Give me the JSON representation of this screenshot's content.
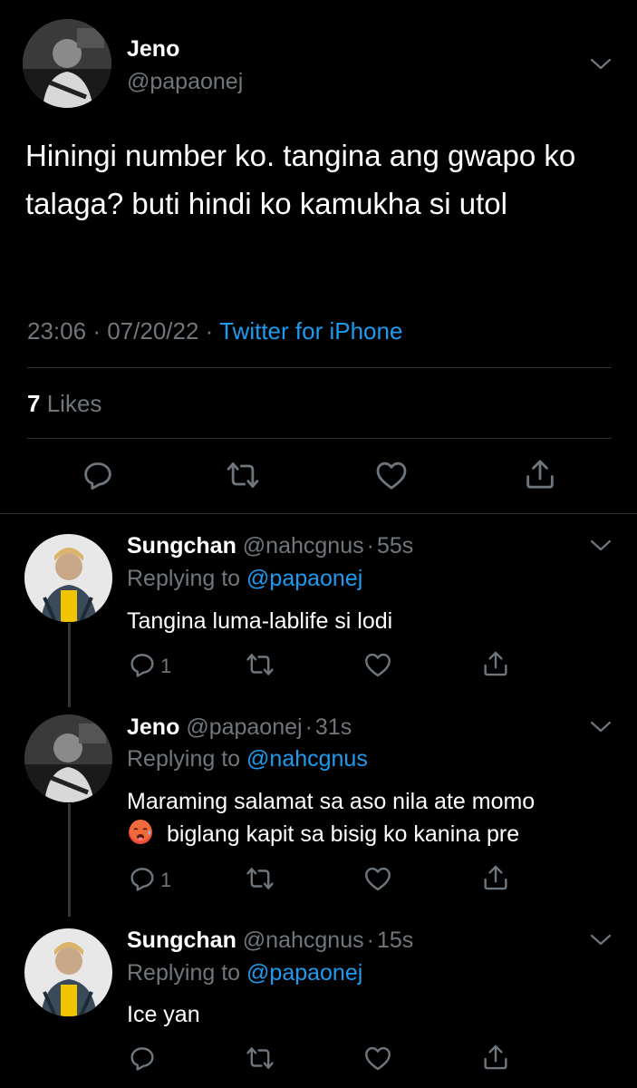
{
  "main_tweet": {
    "display_name": "Jeno",
    "handle": "@papaonej",
    "text": "Hiningi number ko. tangina ang gwapo ko talaga? buti hindi ko kamukha si utol",
    "time": "23:06",
    "date": "07/20/22",
    "source": "Twitter for iPhone",
    "likes_count": "7",
    "likes_label": "Likes",
    "separator": "·"
  },
  "replies": [
    {
      "display_name": "Sungchan",
      "handle": "@nahcgnus",
      "age": "55s",
      "replying_prefix": "Replying to",
      "replying_to": "@papaonej",
      "text": "Tangina luma-lablife si lodi",
      "reply_count": "1"
    },
    {
      "display_name": "Jeno",
      "handle": "@papaonej",
      "age": "31s",
      "replying_prefix": "Replying to",
      "replying_to": "@nahcgnus",
      "text_line1": "Maraming salamat sa aso nila ate momo",
      "text_line2": "biglang kapit sa bisig ko kanina pre",
      "emoji": "hot-face-emoji",
      "reply_count": "1"
    },
    {
      "display_name": "Sungchan",
      "handle": "@nahcgnus",
      "age": "15s",
      "replying_prefix": "Replying to",
      "replying_to": "@papaonej",
      "text": "Ice yan",
      "reply_count": ""
    }
  ],
  "icons": [
    "reply-icon",
    "retweet-icon",
    "like-icon",
    "share-icon",
    "chevron-down-icon"
  ],
  "colors": {
    "background": "#000000",
    "text": "#ffffff",
    "muted": "#71767b",
    "link": "#1d9bf0",
    "divider": "#2f3336"
  }
}
